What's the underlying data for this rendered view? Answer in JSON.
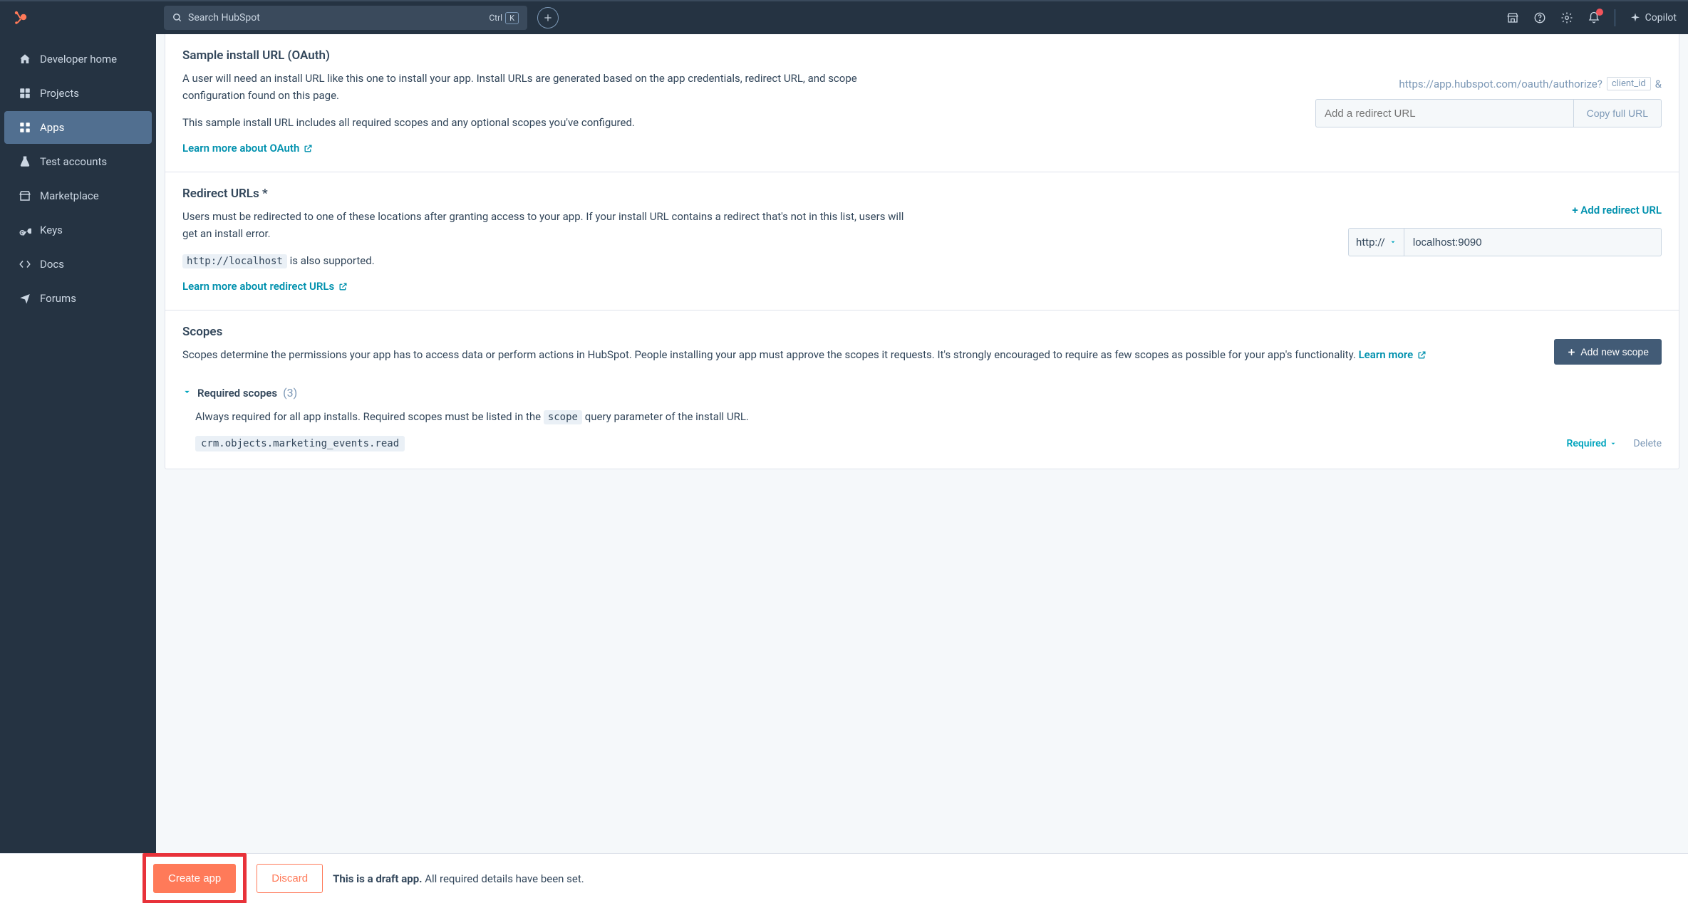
{
  "topbar": {
    "search_placeholder": "Search HubSpot",
    "ctrl_label": "Ctrl",
    "k_label": "K",
    "copilot_label": "Copilot"
  },
  "sidebar": {
    "items": [
      {
        "label": "Developer home"
      },
      {
        "label": "Projects"
      },
      {
        "label": "Apps"
      },
      {
        "label": "Test accounts"
      },
      {
        "label": "Marketplace"
      },
      {
        "label": "Keys"
      },
      {
        "label": "Docs"
      },
      {
        "label": "Forums"
      }
    ]
  },
  "oauth": {
    "title": "Sample install URL (OAuth)",
    "desc1": "A user will need an install URL like this one to install your app. Install URLs are generated based on the app credentials, redirect URL, and scope configuration found on this page.",
    "desc2": "This sample install URL includes all required scopes and any optional scopes you've configured.",
    "learn": "Learn more about OAuth",
    "url_base": "https://app.hubspot.com/oauth/authorize?",
    "client_id_label": "client_id",
    "amp": "&",
    "redirect_placeholder": "Add a redirect URL",
    "copy_btn": "Copy full URL"
  },
  "redirect": {
    "title": "Redirect URLs",
    "star": "*",
    "desc": "Users must be redirected to one of these locations after granting access to your app. If your install URL contains a redirect that's not in this list, users will get an install error.",
    "localhost_code": "http://localhost",
    "also_supported": " is also supported.",
    "learn": "Learn more about redirect URLs",
    "add_link": "+ Add redirect URL",
    "proto": "http://",
    "value": "localhost:9090"
  },
  "scopes": {
    "title": "Scopes",
    "desc": "Scopes determine the permissions your app has to access data or perform actions in HubSpot. People installing your app must approve the scopes it requests. It's strongly encouraged to require as few scopes as possible for your app's functionality. ",
    "learn": "Learn more",
    "add_btn": "Add new scope",
    "req_title": "Required scopes",
    "req_count": "(3)",
    "req_note_pre": "Always required for all app installs. Required scopes must be listed in the ",
    "scope_param": "scope",
    "req_note_post": " query parameter of the install URL.",
    "scope1": "crm.objects.marketing_events.read",
    "required_label": "Required",
    "delete_label": "Delete"
  },
  "footer": {
    "create": "Create app",
    "discard": "Discard",
    "draft_bold": "This is a draft app.",
    "draft_rest": " All required details have been set."
  }
}
